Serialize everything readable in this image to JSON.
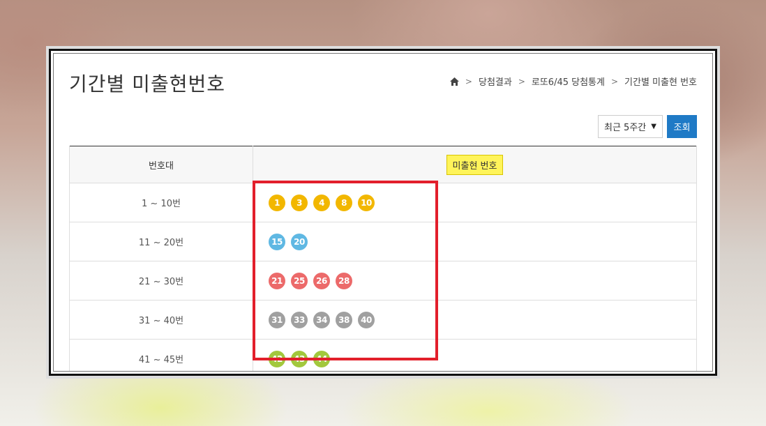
{
  "page": {
    "title": "기간별 미출현번호"
  },
  "breadcrumb": {
    "items": [
      "당첨결과",
      "로또6/45 당첨통계",
      "기간별 미출현 번호"
    ]
  },
  "controls": {
    "period_select": "최근 5주간",
    "search_button": "조회"
  },
  "table": {
    "header_range": "번호대",
    "header_numbers": "미출현 번호",
    "rows": [
      {
        "range": "1 ~ 10번",
        "numbers": [
          "1",
          "3",
          "4",
          "8",
          "10"
        ],
        "color": "#f2b700"
      },
      {
        "range": "11 ~ 20번",
        "numbers": [
          "15",
          "20"
        ],
        "color": "#5fb8e3"
      },
      {
        "range": "21 ~ 30번",
        "numbers": [
          "21",
          "25",
          "26",
          "28"
        ],
        "color": "#ec6a6a"
      },
      {
        "range": "31 ~ 40번",
        "numbers": [
          "31",
          "33",
          "34",
          "38",
          "40"
        ],
        "color": "#a0a0a0"
      },
      {
        "range": "41 ~ 45번",
        "numbers": [
          "42",
          "43",
          "44"
        ],
        "color": "#a2c83d"
      }
    ]
  },
  "colors": {
    "accent_button": "#1f7ac6",
    "highlight_box": "#e21f2b",
    "label_highlight": "#fff45a"
  }
}
